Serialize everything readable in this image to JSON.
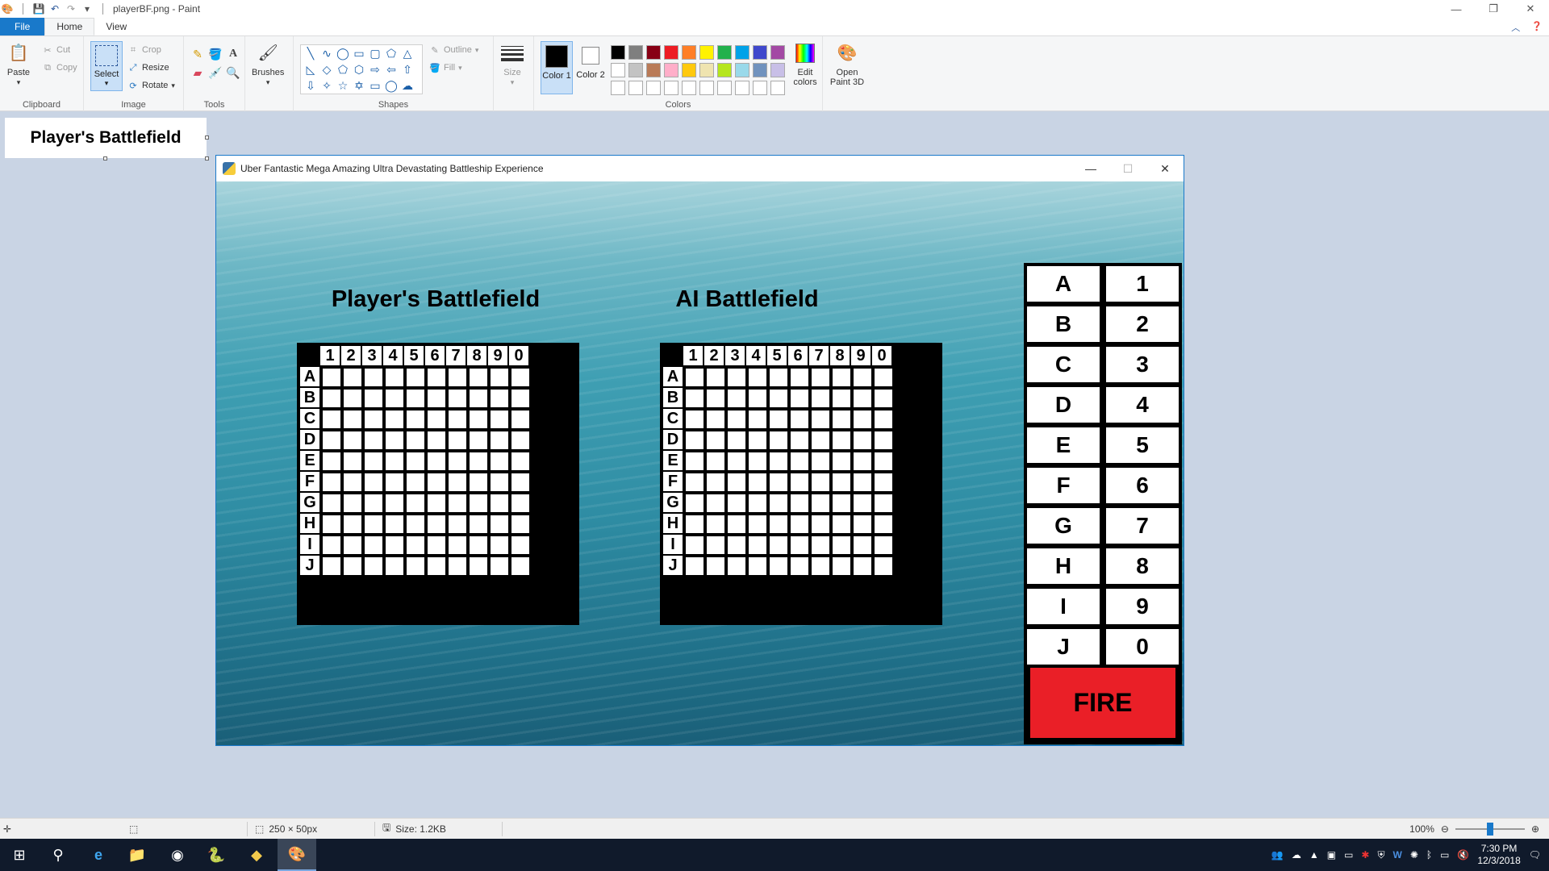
{
  "app": {
    "doc_title": "playerBF.png - Paint",
    "window_controls": [
      "—",
      "❐",
      "✕"
    ]
  },
  "ribbon": {
    "tabs": [
      "File",
      "Home",
      "View"
    ],
    "clipboard": {
      "paste": "Paste",
      "cut": "Cut",
      "copy": "Copy",
      "group": "Clipboard"
    },
    "image": {
      "select": "Select",
      "crop": "Crop",
      "resize": "Resize",
      "rotate": "Rotate",
      "group": "Image"
    },
    "tools": {
      "group": "Tools"
    },
    "brushes": {
      "label": "Brushes"
    },
    "shapes": {
      "outline": "Outline",
      "fill": "Fill",
      "group": "Shapes"
    },
    "size": {
      "label": "Size"
    },
    "colors": {
      "color1": "Color 1",
      "color2": "Color 2",
      "edit": "Edit colors",
      "group": "Colors",
      "color1_value": "#000000",
      "color2_value": "#ffffff",
      "palette": [
        "#000000",
        "#7f7f7f",
        "#880015",
        "#ed1c24",
        "#ff7f27",
        "#fff200",
        "#22b14c",
        "#00a2e8",
        "#3f48cc",
        "#a349a4",
        "#ffffff",
        "#c3c3c3",
        "#b97a57",
        "#ffaec9",
        "#ffc90e",
        "#efe4b0",
        "#b5e61d",
        "#99d9ea",
        "#7092be",
        "#c8bfe7",
        "#ffffff",
        "#ffffff",
        "#ffffff",
        "#ffffff",
        "#ffffff",
        "#ffffff",
        "#ffffff",
        "#ffffff",
        "#ffffff",
        "#ffffff"
      ]
    },
    "paint3d": {
      "label": "Open Paint 3D"
    }
  },
  "canvas": {
    "text": "Player's Battlefield"
  },
  "game": {
    "window_title": "Uber Fantastic Mega Amazing Ultra Devastating Battleship Experience",
    "player_title": "Player's Battlefield",
    "ai_title": "AI Battlefield",
    "col_headers": [
      "1",
      "2",
      "3",
      "4",
      "5",
      "6",
      "7",
      "8",
      "9",
      "0"
    ],
    "row_headers": [
      "A",
      "B",
      "C",
      "D",
      "E",
      "F",
      "G",
      "H",
      "I",
      "J"
    ],
    "letter_buttons": [
      "A",
      "B",
      "C",
      "D",
      "E",
      "F",
      "G",
      "H",
      "I",
      "J"
    ],
    "number_buttons": [
      "1",
      "2",
      "3",
      "4",
      "5",
      "6",
      "7",
      "8",
      "9",
      "0"
    ],
    "fire_label": "FIRE",
    "fire_color": "#ea1f27"
  },
  "status": {
    "dimensions": "250 × 50px",
    "size": "Size: 1.2KB",
    "zoom": "100%",
    "zoom_fraction": 0.5
  },
  "taskbar": {
    "time": "7:30 PM",
    "date": "12/3/2018"
  }
}
